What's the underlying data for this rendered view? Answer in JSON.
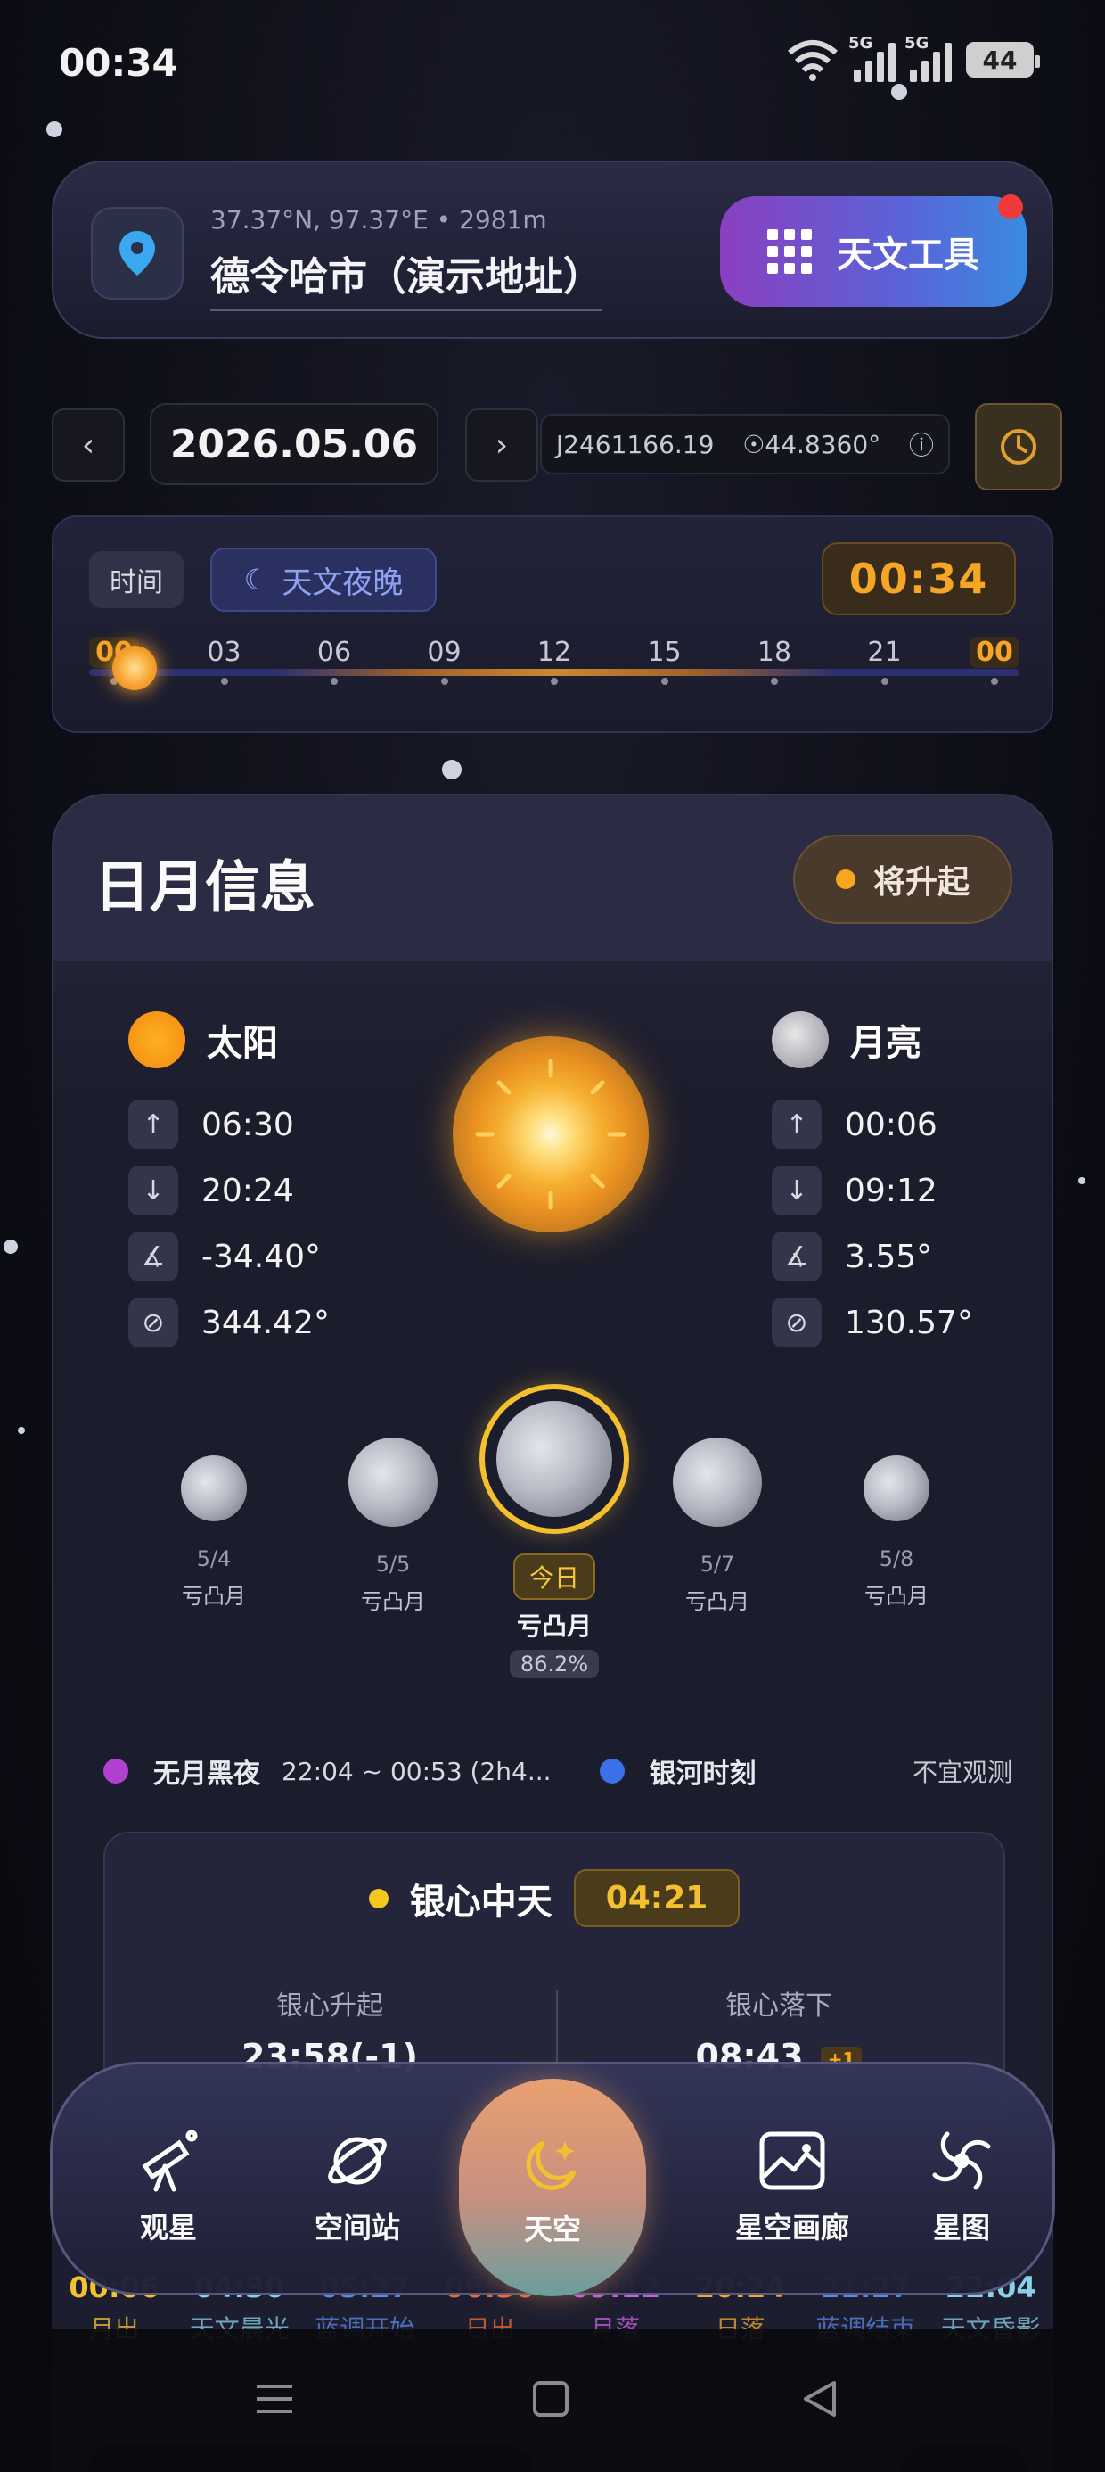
{
  "status_bar": {
    "time": "00:34",
    "net1": "5G",
    "net2": "5G",
    "battery": "44"
  },
  "location": {
    "coords": "37.37°N, 97.37°E • 2981m",
    "name": "德令哈市（演示地址）",
    "tools_label": "天文工具"
  },
  "date_bar": {
    "prev": "‹",
    "date": "2026.05.06",
    "next": "›",
    "julian": "J2461166.19",
    "angle": "☉44.8360°",
    "info": "ⓘ"
  },
  "timeline": {
    "label": "时间",
    "mode": "天文夜晚",
    "current": "00:34",
    "ticks": [
      "00",
      "03",
      "06",
      "09",
      "12",
      "15",
      "18",
      "21",
      "00"
    ],
    "current_position_fraction": 0.03
  },
  "sun_moon": {
    "title": "日月信息",
    "status": "将升起",
    "sun": {
      "name": "太阳",
      "rise": "06:30",
      "set": "20:24",
      "altitude": "-34.40°",
      "azimuth": "344.42°"
    },
    "moon": {
      "name": "月亮",
      "rise": "00:06",
      "set": "09:12",
      "altitude": "3.55°",
      "azimuth": "130.57°"
    },
    "phases": [
      {
        "date": "5/4",
        "name": "亏凸月"
      },
      {
        "date": "5/5",
        "name": "亏凸月"
      },
      {
        "today_tag": "今日",
        "name": "亏凸月",
        "pct": "86.2%"
      },
      {
        "date": "5/7",
        "name": "亏凸月"
      },
      {
        "date": "5/8",
        "name": "亏凸月"
      }
    ],
    "dark_night": {
      "label": "无月黑夜",
      "range": "22:04 ~ 00:53 (2h4..."
    },
    "milky_way": {
      "label": "银河时刻",
      "verdict": "不宜观测"
    },
    "galactic_center": {
      "title": "银心中天",
      "time": "04:21",
      "rise_label": "银心升起",
      "rise_value": "23:58(-1)",
      "set_label": "银心落下",
      "set_value": "08:43",
      "set_badge": "+1"
    }
  },
  "events_strip": [
    {
      "time": "00:06",
      "label": "月出",
      "color": "#f2c230"
    },
    {
      "time": "04:30",
      "label": "天文晨光",
      "color": "#8ad0e8"
    },
    {
      "time": "05:27",
      "label": "蓝调开始",
      "color": "#5a8ae8"
    },
    {
      "time": "06:30",
      "label": "日出",
      "color": "#f26a30"
    },
    {
      "time": "09:12",
      "label": "月落",
      "color": "#c860e0"
    },
    {
      "time": "20:24",
      "label": "日落",
      "color": "#f2a830"
    },
    {
      "time": "21:27",
      "label": "蓝调结束",
      "color": "#5a8ae8"
    },
    {
      "time": "22:04",
      "label": "天文昏影",
      "color": "#8ad0e8"
    }
  ],
  "nav": {
    "observe": "观星",
    "station": "空间站",
    "sky": "天空",
    "gallery": "星空画廊",
    "starmap": "星图"
  },
  "colors": {
    "accent_orange": "#f5a624",
    "accent_gold": "#f5c030",
    "night_blue": "#8ea2f2"
  }
}
